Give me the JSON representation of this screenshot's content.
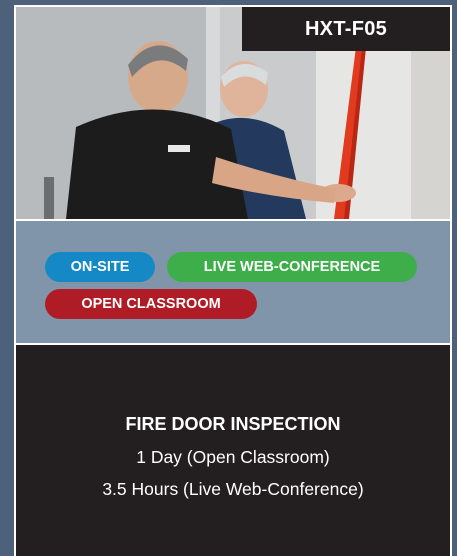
{
  "course": {
    "code": "HXT-F05",
    "title": "FIRE DOOR INSPECTION",
    "durations": [
      "1 Day (Open Classroom)",
      "3.5 Hours (Live Web-Conference)"
    ]
  },
  "badges": {
    "onsite": "ON-SITE",
    "web": "LIVE WEB-CONFERENCE",
    "classroom": "OPEN CLASSROOM"
  },
  "colors": {
    "background": "#4d617a",
    "badge_panel": "#8094aa",
    "dark": "#231f20",
    "onsite": "#1589c5",
    "web": "#3eae4a",
    "classroom": "#b01c26"
  }
}
